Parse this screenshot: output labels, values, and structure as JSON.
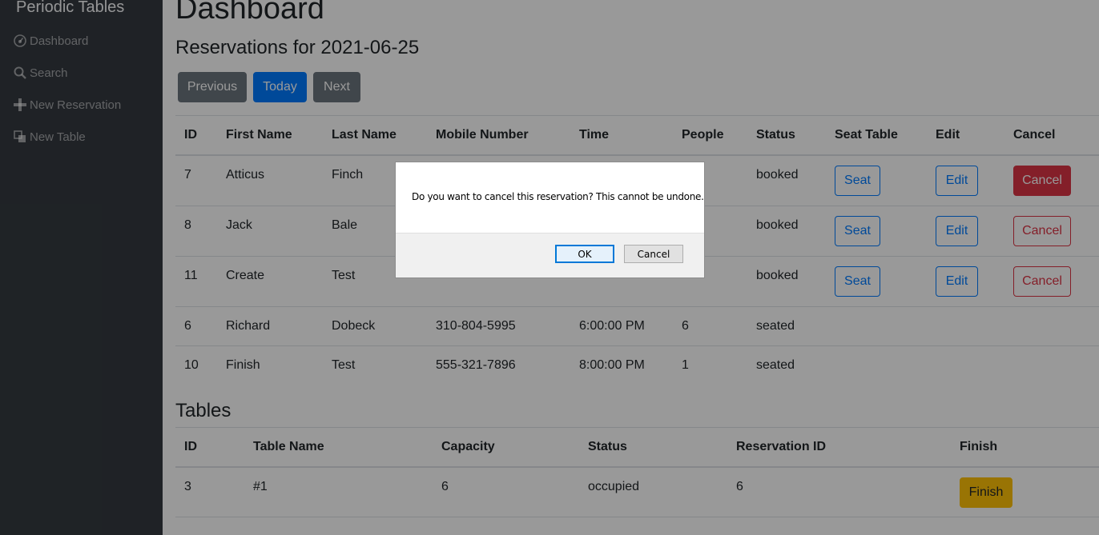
{
  "sidebar": {
    "brand": "Periodic Tables",
    "items": [
      {
        "label": "Dashboard",
        "icon": "dashboard-icon"
      },
      {
        "label": "Search",
        "icon": "search-icon"
      },
      {
        "label": "New Reservation",
        "icon": "plus-icon"
      },
      {
        "label": "New Table",
        "icon": "table-icon"
      }
    ]
  },
  "main": {
    "title": "Dashboard",
    "subtitle": "Reservations for 2021-06-25",
    "nav_buttons": {
      "previous": "Previous",
      "today": "Today",
      "next": "Next"
    }
  },
  "reservations": {
    "headers": [
      "ID",
      "First Name",
      "Last Name",
      "Mobile Number",
      "Time",
      "People",
      "Status",
      "Seat Table",
      "Edit",
      "Cancel"
    ],
    "rows": [
      {
        "id": "7",
        "first": "Atticus",
        "last": "Finch",
        "mobile": "",
        "time": "",
        "people": "",
        "status": "booked",
        "seat": "Seat",
        "edit": "Edit",
        "cancel": "Cancel"
      },
      {
        "id": "8",
        "first": "Jack",
        "last": "Bale",
        "mobile": "",
        "time": "",
        "people": "",
        "status": "booked",
        "seat": "Seat",
        "edit": "Edit",
        "cancel": "Cancel"
      },
      {
        "id": "11",
        "first": "Create",
        "last": "Test",
        "mobile": "",
        "time": "",
        "people": "",
        "status": "booked",
        "seat": "Seat",
        "edit": "Edit",
        "cancel": "Cancel"
      },
      {
        "id": "6",
        "first": "Richard",
        "last": "Dobeck",
        "mobile": "310-804-5995",
        "time": "6:00:00 PM",
        "people": "6",
        "status": "seated"
      },
      {
        "id": "10",
        "first": "Finish",
        "last": "Test",
        "mobile": "555-321-7896",
        "time": "8:00:00 PM",
        "people": "1",
        "status": "seated"
      }
    ]
  },
  "tables": {
    "title": "Tables",
    "headers": [
      "ID",
      "Table Name",
      "Capacity",
      "Status",
      "Reservation ID",
      "Finish"
    ],
    "rows": [
      {
        "id": "3",
        "name": "#1",
        "capacity": "6",
        "status": "occupied",
        "reservation_id": "6",
        "finish": "Finish"
      }
    ]
  },
  "dialog": {
    "message": "Do you want to cancel this reservation? This cannot be undone.",
    "ok": "OK",
    "cancel": "Cancel"
  },
  "colors": {
    "sidebar_bg": "#343a40",
    "primary": "#007bff",
    "danger": "#dc3545",
    "warning": "#ffc107",
    "secondary": "#6c757d"
  }
}
